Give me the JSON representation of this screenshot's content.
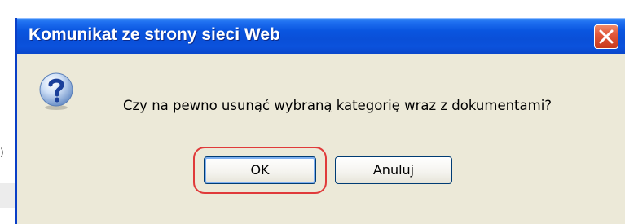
{
  "dialog": {
    "title": "Komunikat ze strony sieci Web",
    "message": "Czy na pewno usunąć wybraną kategorię wraz z dokumentami?",
    "icon": "question-icon",
    "ok_label": "OK",
    "cancel_label": "Anuluj"
  },
  "behind": {
    "stub_text": ")"
  },
  "colors": {
    "titlebar": "#0a4fd8",
    "dialog_bg": "#ece9d8",
    "close_button": "#e2583a",
    "highlight": "#e03a3a"
  }
}
